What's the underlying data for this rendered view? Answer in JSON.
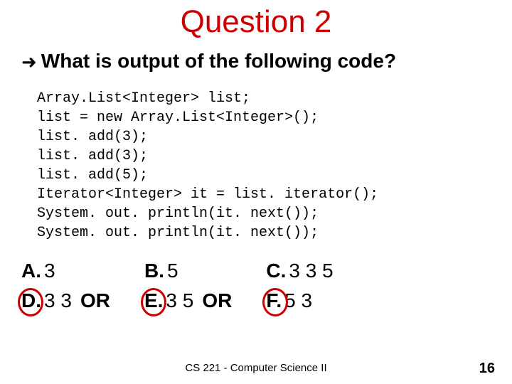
{
  "title": "Question 2",
  "bullet_glyph": "➜",
  "prompt": "What is output of the following code?",
  "code": "Array.List<Integer> list;\nlist = new Array.List<Integer>();\nlist. add(3);\nlist. add(3);\nlist. add(5);\nIterator<Integer> it = list. iterator();\nSystem. out. println(it. next());\nSystem. out. println(it. next());",
  "choices": {
    "a": {
      "label": "A.",
      "value": "3"
    },
    "b": {
      "label": "B.",
      "value": "5"
    },
    "c": {
      "label": "C.",
      "value": "3 3 5"
    },
    "d": {
      "label": "D.",
      "value": "3 3",
      "or_text": "OR",
      "circled": true
    },
    "e": {
      "label": "E.",
      "value": "3 5",
      "or_text": "OR",
      "circled": true
    },
    "f": {
      "label": "F.",
      "value": "5 3",
      "circled": true
    }
  },
  "footer": "CS 221 - Computer Science II",
  "page_number": "16"
}
